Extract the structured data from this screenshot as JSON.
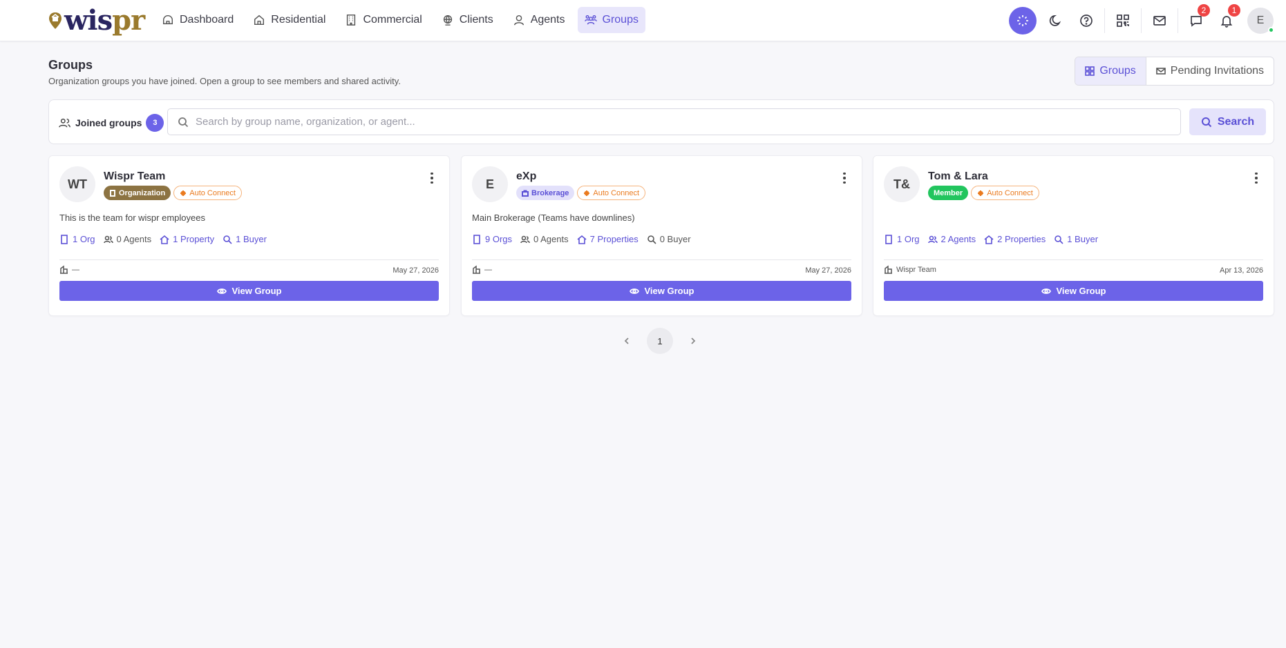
{
  "brand": {
    "logo_text_a": "wis",
    "logo_text_b": "pr"
  },
  "nav": [
    {
      "label": "Dashboard",
      "icon": "dashboard-icon"
    },
    {
      "label": "Residential",
      "icon": "home-icon"
    },
    {
      "label": "Commercial",
      "icon": "building-icon"
    },
    {
      "label": "Clients",
      "icon": "globe-icon"
    },
    {
      "label": "Agents",
      "icon": "user-icon"
    },
    {
      "label": "Groups",
      "icon": "users-group-icon",
      "active": true
    }
  ],
  "topbar": {
    "messages_count": "2",
    "notifications_count": "1",
    "avatar_initial": "E"
  },
  "page": {
    "title": "Groups",
    "subtitle": "Organization groups you have joined. Open a group to see members and shared activity.",
    "toggle_groups": "Groups",
    "toggle_pending": "Pending Invitations"
  },
  "filter": {
    "joined_label": "Joined groups",
    "joined_count": "3",
    "search_placeholder": "Search by group name, organization, or agent...",
    "search_value": "",
    "search_button": "Search"
  },
  "cards": [
    {
      "initials": "WT",
      "name": "Wispr Team",
      "role_tag": "Organization",
      "auto_tag": "Auto Connect",
      "description": "This is the team for wispr employees",
      "stats": {
        "orgs": "1 Org",
        "agents": "0 Agents",
        "properties": "1 Property",
        "buyers": "1 Buyer"
      },
      "footer_left": "—",
      "date": "May 27, 2026",
      "button": "View Group"
    },
    {
      "initials": "E",
      "name": "eXp",
      "role_tag": "Brokerage",
      "auto_tag": "Auto Connect",
      "description": "Main Brokerage (Teams have downlines)",
      "stats": {
        "orgs": "9 Orgs",
        "agents": "0 Agents",
        "properties": "7 Properties",
        "buyers": "0 Buyer"
      },
      "footer_left": "—",
      "date": "May 27, 2026",
      "button": "View Group"
    },
    {
      "initials": "T&",
      "name": "Tom & Lara",
      "role_tag": "Member",
      "auto_tag": "Auto Connect",
      "description": "",
      "stats": {
        "orgs": "1 Org",
        "agents": "2 Agents",
        "properties": "2 Properties",
        "buyers": "1 Buyer"
      },
      "footer_left": "Wispr Team",
      "date": "Apr 13, 2026",
      "button": "View Group"
    }
  ],
  "pagination": {
    "current": "1"
  },
  "colors": {
    "accent": "#6c63e8",
    "organization_tag": "#8c7342",
    "brokerage_tag_bg": "#e3e1fb",
    "member_tag": "#22c55e",
    "auto_connect": "#ea7a1e",
    "badge_red": "#ef4444"
  }
}
